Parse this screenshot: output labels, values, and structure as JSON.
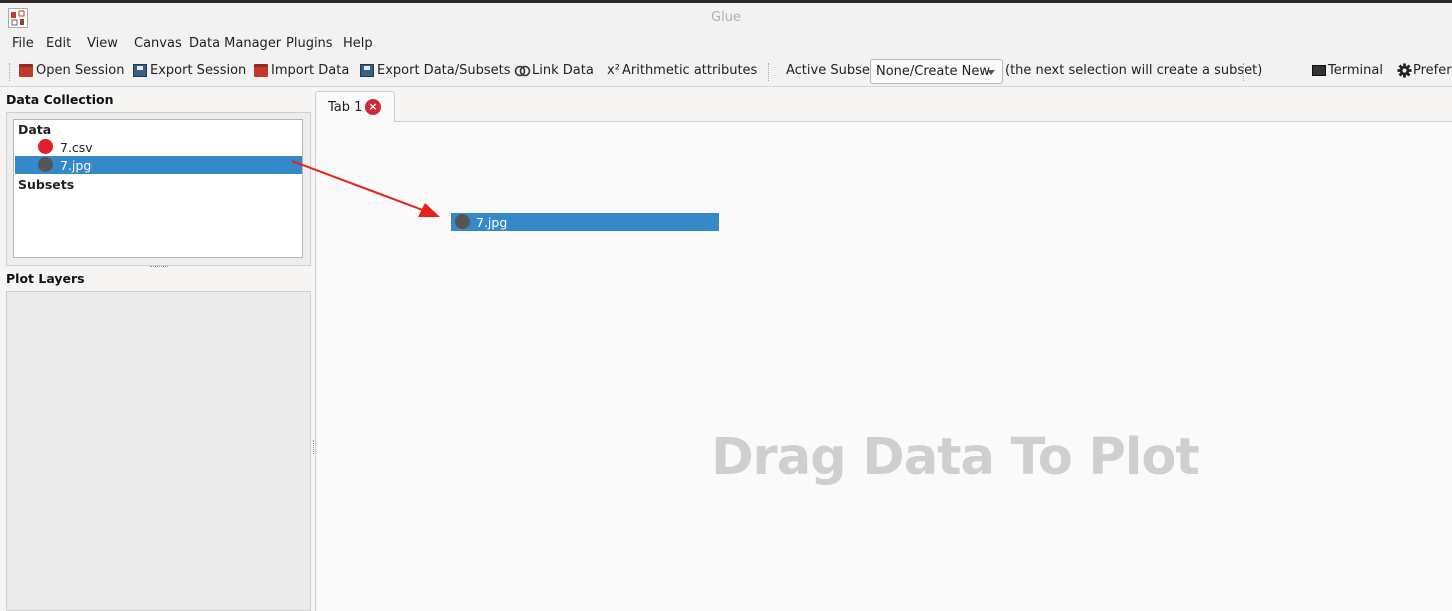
{
  "window": {
    "title": "Glue"
  },
  "menu": [
    "File",
    "Edit",
    "View",
    "Canvas",
    "Data Manager",
    "Plugins",
    "Help"
  ],
  "toolbar": {
    "open_session": "Open Session",
    "export_session": "Export Session",
    "import_data": "Import Data",
    "export_data": "Export Data/Subsets",
    "link_data": "Link Data",
    "arith_icon": "x²",
    "arithmetic": "Arithmetic attributes",
    "active_subset_label": "Active Subset:",
    "active_subset_value": "None/Create New",
    "subset_hint": "(the next selection will create a subset)",
    "terminal": "Terminal",
    "preferences": "Preferences"
  },
  "sidebar": {
    "data_collection_title": "Data Collection",
    "data_header": "Data",
    "items": [
      {
        "label": "7.csv",
        "color": "#e02030",
        "selected": false
      },
      {
        "label": "7.jpg",
        "color": "#555555",
        "selected": true
      }
    ],
    "subsets_header": "Subsets",
    "plot_layers_title": "Plot Layers"
  },
  "tabs": [
    {
      "label": "Tab 1"
    }
  ],
  "canvas": {
    "placeholder": "Drag Data To Plot",
    "dragged_item": {
      "label": "7.jpg",
      "color": "#555555"
    }
  },
  "colors": {
    "selection": "#3689c8",
    "arrow": "#e8201c",
    "close": "#d0253a"
  }
}
